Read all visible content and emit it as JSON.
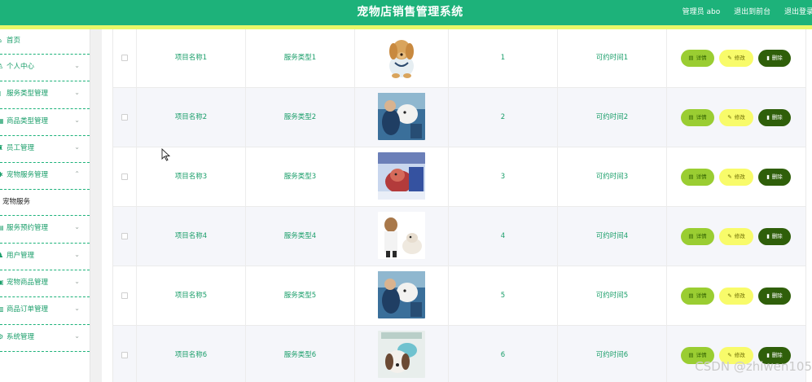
{
  "app": {
    "title": "宠物店销售管理系统",
    "user_label": "管理员 abo",
    "front_link": "退出到前台",
    "logout_link": "退出登录"
  },
  "colors": {
    "primary": "#1db27a",
    "accent_strip": "#e8f76a",
    "detail_button": "#9acd32",
    "edit_button": "#f8fb6a",
    "delete_button": "#2f5f0a"
  },
  "sidebar": {
    "items": [
      {
        "label": "首页",
        "icon": "home-icon",
        "has_chevron": false
      },
      {
        "label": "个人中心",
        "icon": "user-icon",
        "has_chevron": true
      },
      {
        "label": "服务类型管理",
        "icon": "doc-icon",
        "has_chevron": true
      },
      {
        "label": "商品类型管理",
        "icon": "grid-icon",
        "has_chevron": true
      },
      {
        "label": "员工管理",
        "icon": "staff-icon",
        "has_chevron": true
      },
      {
        "label": "宠物服务管理",
        "icon": "paw-icon",
        "has_chevron": true,
        "expanded": true
      }
    ],
    "sub_item": "宠物服务",
    "items_after": [
      {
        "label": "服务预约管理",
        "icon": "calendar-icon"
      },
      {
        "label": "用户管理",
        "icon": "users-icon"
      },
      {
        "label": "宠物商品管理",
        "icon": "box-icon"
      },
      {
        "label": "商品订单管理",
        "icon": "order-icon"
      },
      {
        "label": "系统管理",
        "icon": "settings-icon"
      }
    ]
  },
  "table": {
    "rows": [
      {
        "name": "项目名称1",
        "type": "服务类型1",
        "image": "dog-golden-vet",
        "num": "1",
        "time": "可约时间1"
      },
      {
        "name": "项目名称2",
        "type": "服务类型2",
        "image": "dog-grooming",
        "num": "2",
        "time": "可约时间2"
      },
      {
        "name": "项目名称3",
        "type": "服务类型3",
        "image": "dog-red-vet",
        "num": "3",
        "time": "可约时间3"
      },
      {
        "name": "项目名称4",
        "type": "服务类型4",
        "image": "dog-vet-exam",
        "num": "4",
        "time": "可约时间4"
      },
      {
        "name": "项目名称5",
        "type": "服务类型5",
        "image": "dog-grooming",
        "num": "5",
        "time": "可约时间5"
      },
      {
        "name": "项目名称6",
        "type": "服务类型6",
        "image": "dog-bath",
        "num": "6",
        "time": "可约时间6"
      }
    ],
    "actions": {
      "detail": "详情",
      "edit": "修改",
      "delete": "删除"
    }
  },
  "watermark": "CSDN @zhiwen105"
}
